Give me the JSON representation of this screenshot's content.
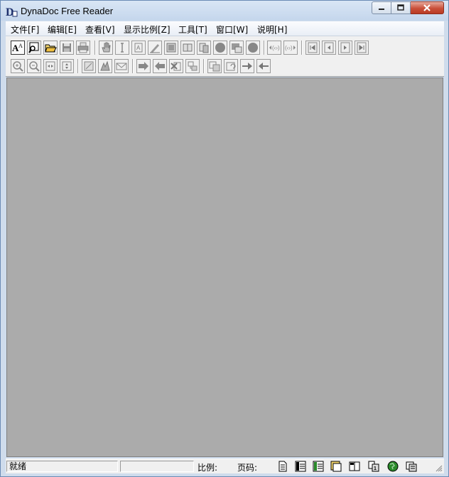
{
  "window": {
    "title": "DynaDoc Free Reader",
    "app_icon": "dynadoc-logo-icon"
  },
  "titlebar_controls": [
    "minimize-icon",
    "maximize-icon",
    "close-icon"
  ],
  "menu": [
    {
      "label": "文件[F]"
    },
    {
      "label": "编辑[E]"
    },
    {
      "label": "查看[V]"
    },
    {
      "label": "显示比例[Z]"
    },
    {
      "label": "工具[T]"
    },
    {
      "label": "窗口[W]"
    },
    {
      "label": "说明[H]"
    }
  ],
  "toolbar_row1": [
    "text-select-icon",
    "find-icon",
    "open-folder-icon",
    "save-icon",
    "print-icon",
    "hand-tool-icon",
    "text-cursor-icon",
    "copy-text-icon",
    "pencil-icon",
    "image-select-icon",
    "bookmark-icon",
    "annotation-icon",
    "circle-icon",
    "highlight-icon",
    "circle-icon",
    "scroll-left-icon",
    "scroll-right-icon",
    "first-page-icon",
    "previous-page-icon",
    "next-page-icon",
    "last-page-icon"
  ],
  "toolbar_row2": [
    "zoom-in-icon",
    "zoom-out-icon",
    "fit-width-icon",
    "fit-height-icon",
    "select-area-icon",
    "stamp-icon",
    "mail-icon",
    "forward-icon",
    "back-icon",
    "delete-icon",
    "link-icon",
    "page-layout-icon",
    "rotate-icon",
    "arrow-right-icon",
    "arrow-left-icon"
  ],
  "status": {
    "ready": "就绪",
    "info": "",
    "scale_label": "比例:",
    "page_label": "页码:",
    "buttons": [
      "single-page-icon",
      "continuous-page-icon",
      "facing-page-icon",
      "thumbnail-icon",
      "book-view-icon",
      "page-info-icon",
      "globe-icon",
      "properties-icon"
    ]
  },
  "colors": {
    "canvas": "#ababab",
    "chrome": "#f0f0f0",
    "titlebar": "#cfdcec",
    "close_button": "#c9503a"
  }
}
